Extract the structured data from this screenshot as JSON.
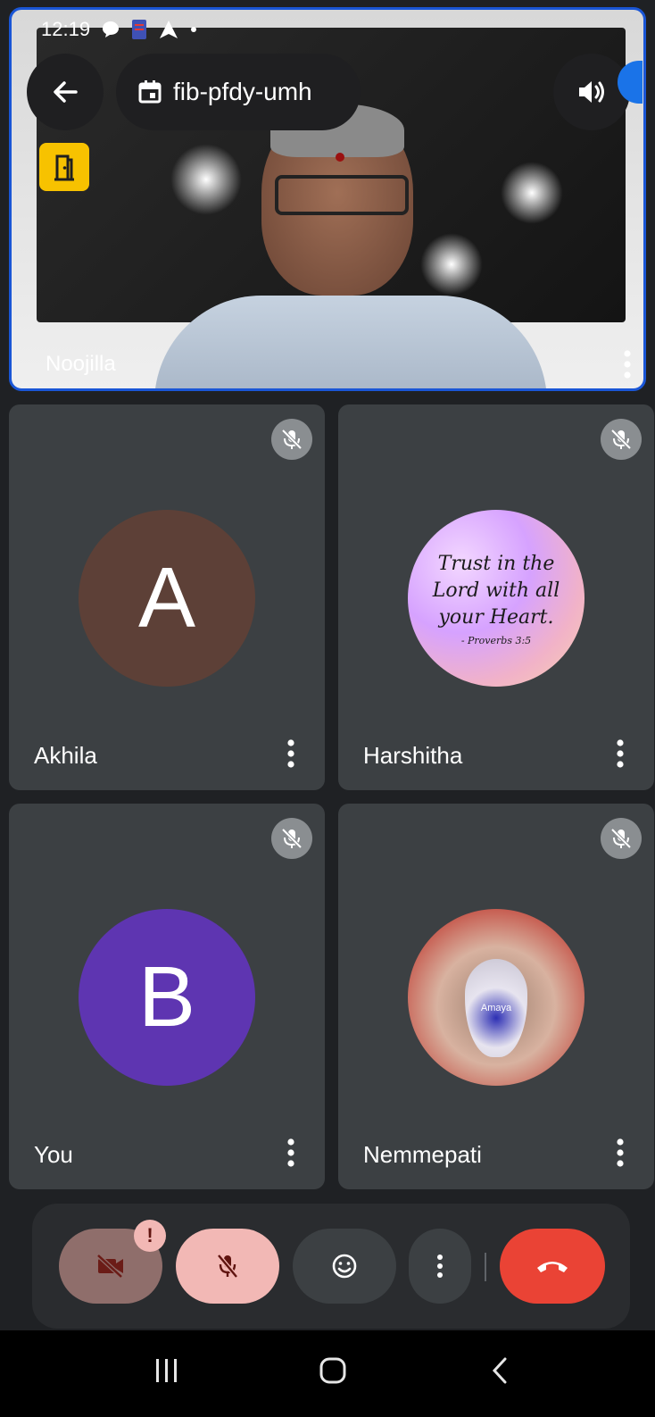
{
  "status_bar": {
    "time": "12:19"
  },
  "header": {
    "meeting_code": "fib-pfdy-umh"
  },
  "featured": {
    "name": "Noojilla"
  },
  "tiles": [
    {
      "name": "Akhila",
      "avatar_letter": "A",
      "avatar_color": "#5d4037"
    },
    {
      "name": "Harshitha",
      "avatar_image_text": [
        "Trust in the",
        "Lord with all",
        "your Heart."
      ],
      "avatar_caption": "- Proverbs 3:5"
    },
    {
      "name": "You",
      "avatar_letter": "B",
      "avatar_color": "#5e35b1"
    },
    {
      "name": "Nemmepati",
      "avatar_image_text": [
        "Amaya"
      ]
    }
  ],
  "controls": {
    "camera_warning": "!",
    "icons": [
      "camera-off-icon",
      "mic-off-icon",
      "emoji-icon",
      "more-vert-icon",
      "call-end-icon"
    ]
  },
  "colors": {
    "accent_blue": "#1a73e8",
    "end_call_red": "#ea4335",
    "tile_bg": "#3c4043"
  }
}
